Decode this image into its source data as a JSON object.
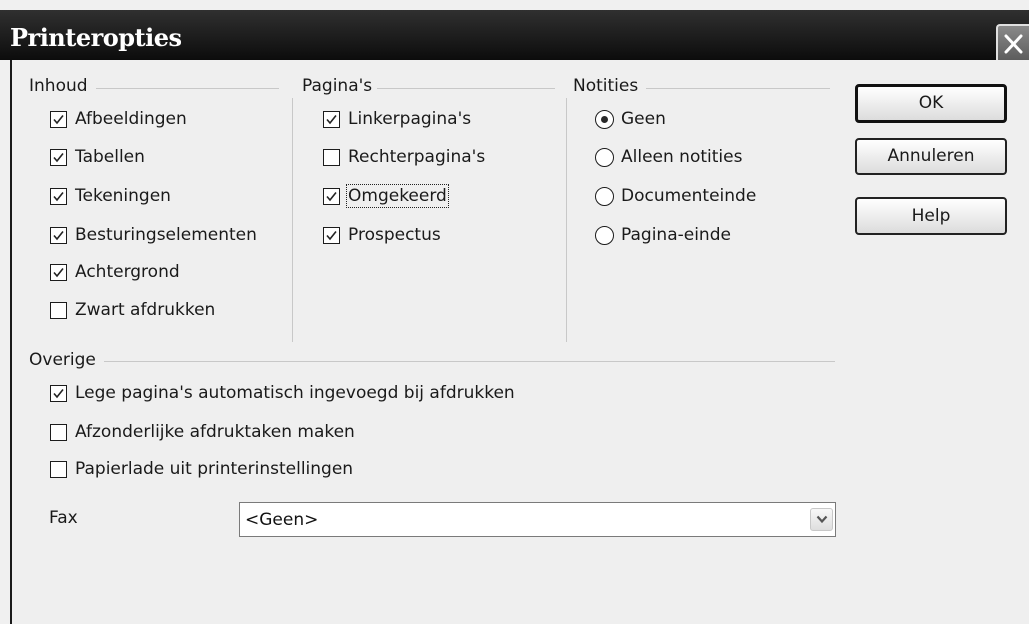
{
  "dialog": {
    "title": "Printeropties"
  },
  "groups": {
    "inhoud": {
      "title": "Inhoud",
      "items": [
        {
          "label": "Afbeeldingen",
          "checked": true
        },
        {
          "label": "Tabellen",
          "checked": true
        },
        {
          "label": "Tekeningen",
          "checked": true
        },
        {
          "label": "Besturingselementen",
          "checked": true
        },
        {
          "label": "Achtergrond",
          "checked": true
        },
        {
          "label": "Zwart afdrukken",
          "checked": false
        }
      ]
    },
    "paginas": {
      "title": "Pagina's",
      "items": [
        {
          "label": "Linkerpagina's",
          "checked": true
        },
        {
          "label": "Rechterpagina's",
          "checked": false
        },
        {
          "label": "Omgekeerd",
          "checked": true
        },
        {
          "label": "Prospectus",
          "checked": true
        }
      ]
    },
    "notities": {
      "title": "Notities",
      "selected": "Geen",
      "items": [
        {
          "label": "Geen",
          "selected": true
        },
        {
          "label": "Alleen notities",
          "selected": false
        },
        {
          "label": "Documenteinde",
          "selected": false
        },
        {
          "label": "Pagina-einde",
          "selected": false
        }
      ]
    },
    "overige": {
      "title": "Overige",
      "items": [
        {
          "label": "Lege pagina's automatisch ingevoegd bij afdrukken",
          "checked": true
        },
        {
          "label": "Afzonderlijke afdruktaken maken",
          "checked": false
        },
        {
          "label": "Papierlade uit printerinstellingen",
          "checked": false
        }
      ]
    }
  },
  "fax": {
    "label": "Fax",
    "value": "<Geen>"
  },
  "buttons": {
    "ok": "OK",
    "cancel": "Annuleren",
    "help": "Help"
  },
  "icons": {
    "close": "close-icon",
    "check": "checkmark-icon",
    "dropdown": "chevron-down-icon"
  },
  "colors": {
    "titlebar": "#1a1a1a",
    "dialog_bg": "#efefef"
  }
}
